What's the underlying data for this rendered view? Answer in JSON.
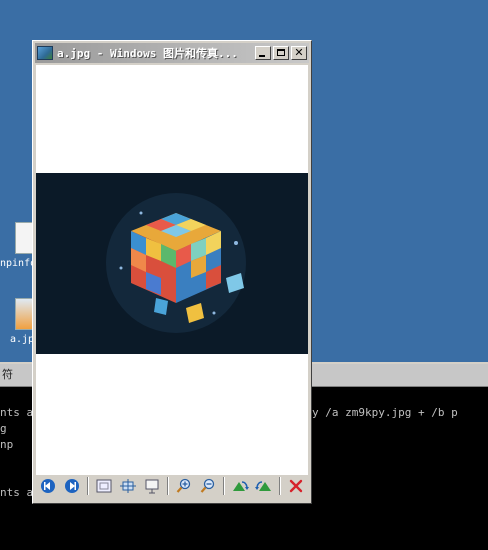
{
  "desktop": {
    "icons": [
      {
        "label": "npinfo"
      },
      {
        "label": "a.jp"
      }
    ]
  },
  "console": {
    "title": "符",
    "lines": [
      "nts a",
      "g",
      "np",
      "",
      "nts a"
    ],
    "line_right": "y /a zm9kpy.jpg + /b p"
  },
  "viewer": {
    "title": "a.jpg - Windows 图片和传真..."
  },
  "toolbar": {
    "buttons": [
      "previous-image",
      "next-image",
      "best-fit",
      "actual-size",
      "slideshow",
      "zoom-in",
      "zoom-out",
      "rotate-clockwise",
      "rotate-counterclockwise",
      "delete"
    ]
  },
  "colors": {
    "desktop": "#3a6ea5",
    "titlebar": "#a8a8a8",
    "photo_bg": "#0b1a28",
    "delete": "#d6212a"
  }
}
